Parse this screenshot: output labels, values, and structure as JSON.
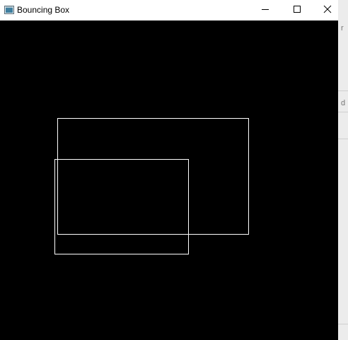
{
  "window": {
    "title": "Bouncing Box",
    "icon": "app-window-icon",
    "controls": {
      "minimize": "minimize-icon",
      "maximize": "maximize-icon",
      "close": "close-icon"
    }
  },
  "canvas": {
    "background": "#000000",
    "stroke": "#ffffff",
    "boxes": [
      {
        "name": "box-a"
      },
      {
        "name": "box-b"
      }
    ]
  },
  "background_app": {
    "glyph_top": "r",
    "glyph_mid": "d"
  }
}
